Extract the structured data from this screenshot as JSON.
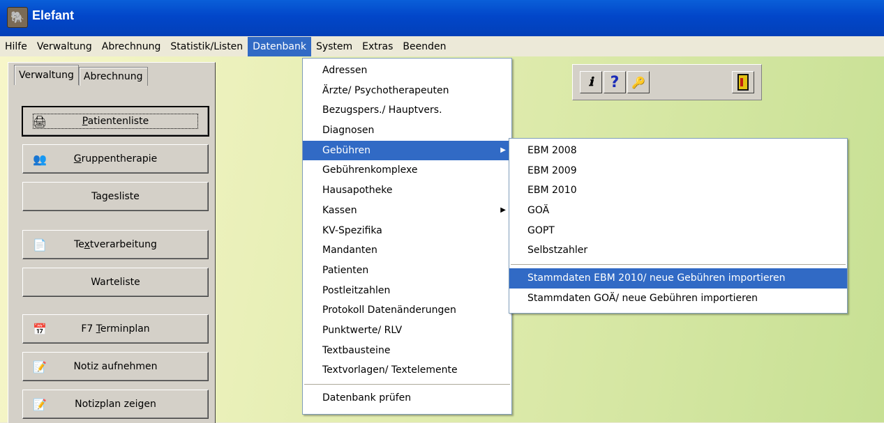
{
  "window": {
    "title": "Elefant",
    "app_icon": "elephant-icon"
  },
  "menubar": {
    "items": [
      "Hilfe",
      "Verwaltung",
      "Abrechnung",
      "Statistik/Listen",
      "Datenbank",
      "System",
      "Extras",
      "Beenden"
    ],
    "active": "Datenbank"
  },
  "left_panel": {
    "tabs": [
      "Verwaltung",
      "Abrechnung"
    ],
    "active_tab": "Verwaltung",
    "buttons": [
      {
        "label_pre": "",
        "label_u": "P",
        "label_post": "atientenliste",
        "icon": "patient-list-icon",
        "focused": true
      },
      {
        "label_pre": "",
        "label_u": "G",
        "label_post": "ruppentherapie",
        "icon": "group-icon"
      },
      {
        "label": "Tagesliste"
      },
      {
        "label_pre": "Te",
        "label_u": "x",
        "label_post": "tverarbeitung",
        "icon": "document-icon"
      },
      {
        "label": "Warteliste"
      },
      {
        "label_pre": "F7 ",
        "label_u": "T",
        "label_post": "erminplan",
        "icon": "calendar-icon"
      },
      {
        "label": "Notiz aufnehmen",
        "icon": "note-icon"
      },
      {
        "label": "Notizplan zeigen",
        "icon": "note-icon"
      }
    ]
  },
  "toolbar": {
    "buttons": [
      "info-icon",
      "help-icon",
      "key-icon",
      "exit-door-icon"
    ],
    "info_glyph": "ℹ",
    "help_glyph": "?",
    "key_glyph": "🔑"
  },
  "datenbank_menu": {
    "items": [
      "Adressen",
      "Ärzte/ Psychotherapeuten",
      "Bezugspers./ Hauptvers.",
      "Diagnosen",
      "Gebühren",
      "Gebührenkomplexe",
      "Hausapotheke",
      "Kassen",
      "KV-Spezifika",
      "Mandanten",
      "Patienten",
      "Postleitzahlen",
      "Protokoll Datenänderungen",
      "Punktwerte/ RLV",
      "Textbausteine",
      "Textvorlagen/ Textelemente"
    ],
    "footer_item": "Datenbank prüfen",
    "highlighted": "Gebühren",
    "submenu_arrow": "▶"
  },
  "gebuehren_submenu": {
    "items": [
      "EBM 2008",
      "EBM 2009",
      "EBM 2010",
      "GOÄ",
      "GOPT",
      "Selbstzahler"
    ],
    "import_items": [
      "Stammdaten EBM 2010/ neue Gebühren importieren",
      "Stammdaten GOÄ/ neue Gebühren importieren"
    ],
    "highlighted": "Stammdaten EBM 2010/ neue Gebühren importieren"
  },
  "colors": {
    "titlebar": "#0246c9",
    "highlight": "#316ac5",
    "background": "#e3edb1"
  }
}
